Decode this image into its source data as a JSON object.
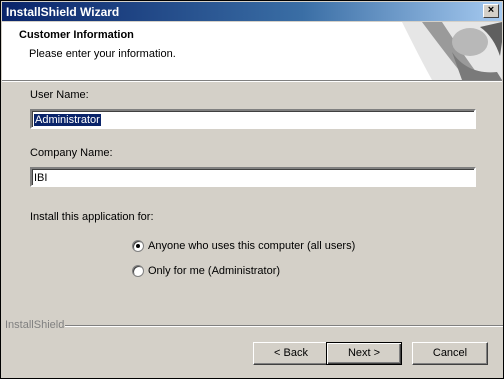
{
  "window": {
    "title": "InstallShield Wizard"
  },
  "header": {
    "title": "Customer Information",
    "subtitle": "Please enter your information."
  },
  "form": {
    "user_name_label": "User Name:",
    "user_name_value": "Administrator",
    "company_name_label": "Company Name:",
    "company_name_value": "IBI",
    "install_for_label": "Install this application for:",
    "options": [
      {
        "label": "Anyone who uses this computer (all users)",
        "selected": true
      },
      {
        "label": "Only for me (Administrator)",
        "selected": false
      }
    ]
  },
  "footer": {
    "brand": "InstallShield",
    "back_label": "< Back",
    "next_label": "Next >",
    "cancel_label": "Cancel"
  },
  "icons": {
    "close": "close-icon",
    "header_art": "wizard-art-icon"
  },
  "colors": {
    "titlebar_start": "#0a246a",
    "titlebar_end": "#a6caf0",
    "face": "#d4d0c8",
    "selection": "#0a246a"
  }
}
